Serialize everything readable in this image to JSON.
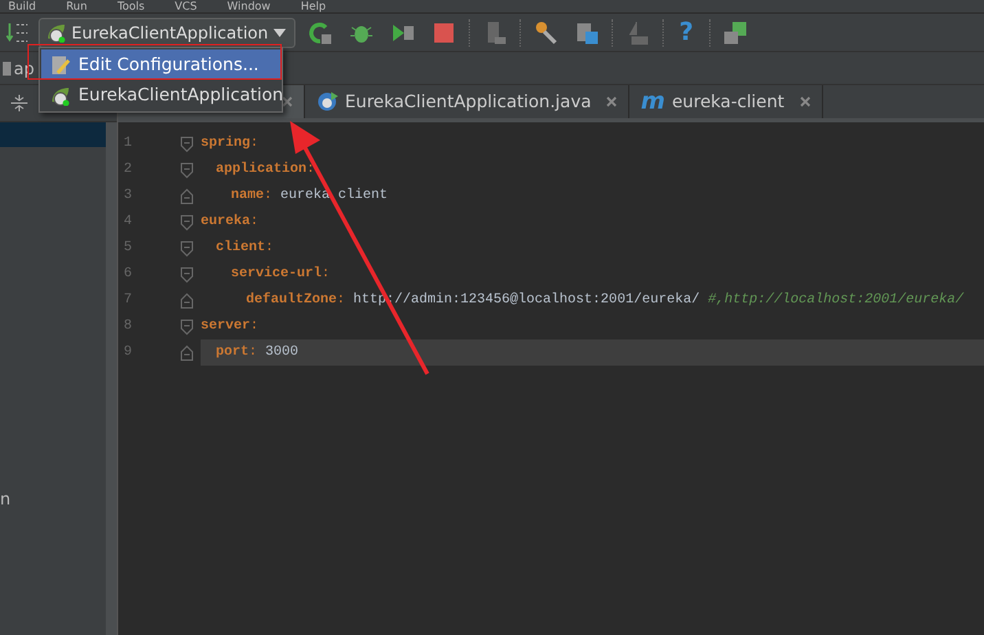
{
  "menu_bar": [
    "Build",
    "Run",
    "Tools",
    "VCS",
    "Window",
    "Help"
  ],
  "toolbar": {
    "run_config": "EurekaClientApplication",
    "help_glyph": "?"
  },
  "run_config_menu": [
    {
      "label": "Edit Configurations...",
      "selected": true,
      "kind": "edit"
    },
    {
      "label": "EurekaClientApplication",
      "selected": false,
      "kind": "app"
    }
  ],
  "breadcrumb": "ap",
  "project_panel": {
    "partial_text": "n"
  },
  "editor_tabs": [
    {
      "selected": true
    },
    {
      "label": "EurekaClientApplication.java",
      "selected": false,
      "kind": "java"
    },
    {
      "label": "eureka-client",
      "selected": false,
      "kind": "maven",
      "glyph": "m"
    }
  ],
  "code_lines": [
    {
      "number": "1",
      "current": false,
      "tokens": [
        {
          "kind": "key",
          "text": "spring"
        },
        {
          "kind": "punct",
          "text": ":"
        }
      ],
      "children": [
        {
          "number": "2",
          "current": false,
          "tokens": [
            {
              "kind": "key",
              "text": "application"
            },
            {
              "kind": "punct",
              "text": ":"
            }
          ],
          "children": [
            {
              "number": "3",
              "current": false,
              "tokens": [
                {
                  "kind": "key",
                  "text": "name"
                },
                {
                  "kind": "punct",
                  "text": ": "
                },
                {
                  "kind": "value",
                  "text": "eureka"
                },
                {
                  "kind": "covered"
                },
                {
                  "kind": "value",
                  "text": "client"
                }
              ]
            }
          ]
        }
      ]
    },
    {
      "number": "4",
      "current": false,
      "tokens": [
        {
          "kind": "key",
          "text": "eureka"
        },
        {
          "kind": "punct",
          "text": ":"
        }
      ],
      "children": [
        {
          "number": "5",
          "current": false,
          "tokens": [
            {
              "kind": "key",
              "text": "client"
            },
            {
              "kind": "punct",
              "text": ":"
            }
          ],
          "children": [
            {
              "number": "6",
              "current": false,
              "tokens": [
                {
                  "kind": "key",
                  "text": "service-url"
                },
                {
                  "kind": "punct",
                  "text": ":"
                }
              ],
              "children": [
                {
                  "number": "7",
                  "current": false,
                  "tokens": [
                    {
                      "kind": "key",
                      "text": "defaultZone"
                    },
                    {
                      "kind": "punct",
                      "text": ": "
                    },
                    {
                      "kind": "value",
                      "text": "http://admin:123456@localhost:2001/eureka/ "
                    },
                    {
                      "kind": "comment",
                      "text": "#,http://localhost:2001/eureka/"
                    }
                  ]
                }
              ]
            }
          ]
        }
      ]
    },
    {
      "number": "8",
      "current": false,
      "tokens": [
        {
          "kind": "key",
          "text": "server"
        },
        {
          "kind": "punct",
          "text": ":"
        }
      ],
      "children": [
        {
          "number": "9",
          "current": true,
          "tokens": [
            {
              "kind": "key",
              "text": "port"
            },
            {
              "kind": "punct",
              "text": ": "
            },
            {
              "kind": "value",
              "text": "3000"
            }
          ]
        }
      ]
    }
  ],
  "annotation": {
    "highlight": true,
    "arrow": true
  }
}
